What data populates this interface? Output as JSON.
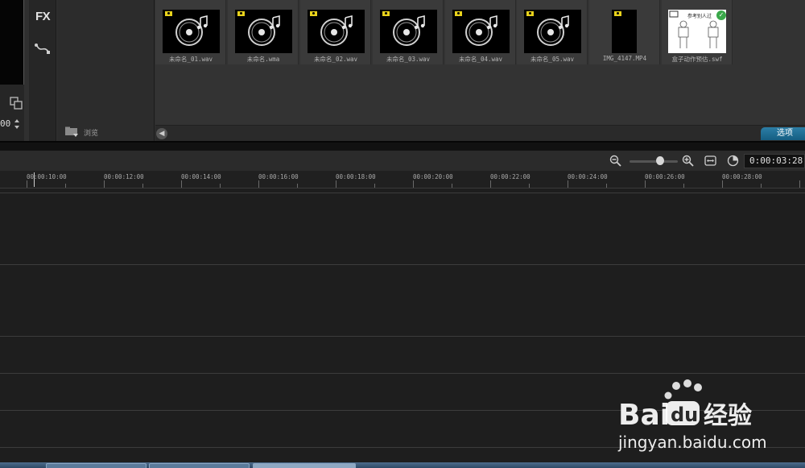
{
  "left_panel": {
    "timecode_fragment": "00"
  },
  "fx_strip": {
    "fx_label": "FX"
  },
  "tree_panel": {
    "browse_label": "浏览"
  },
  "library": {
    "items": [
      {
        "name": "未命名_01.wav",
        "kind": "audio"
      },
      {
        "name": "未命名.wma",
        "kind": "audio"
      },
      {
        "name": "未命名_02.wav",
        "kind": "audio"
      },
      {
        "name": "未命名_03.wav",
        "kind": "audio"
      },
      {
        "name": "未命名_04.wav",
        "kind": "audio"
      },
      {
        "name": "未命名_05.wav",
        "kind": "audio"
      },
      {
        "name": "IMG_4147.MP4",
        "kind": "video"
      },
      {
        "name": "盒子动作预估.swf",
        "kind": "flash",
        "thumb_text": "参考别人过"
      }
    ],
    "options_label": "选项"
  },
  "timeline": {
    "timecode": "0:00:03:28",
    "ruler_labels": [
      "00:00:10:00",
      "00:00:12:00",
      "00:00:14:00",
      "00:00:16:00",
      "00:00:18:00",
      "00:00:20:00",
      "00:00:22:00",
      "00:00:24:00",
      "00:00:26:00",
      "00:00:28:00"
    ]
  },
  "watermark": {
    "brand": "Baidu经验",
    "url": "jingyan.baidu.com"
  },
  "colors": {
    "accent_blue": "#1f6f96",
    "badge_yellow": "#e8d21c",
    "check_green": "#3aa84a"
  }
}
